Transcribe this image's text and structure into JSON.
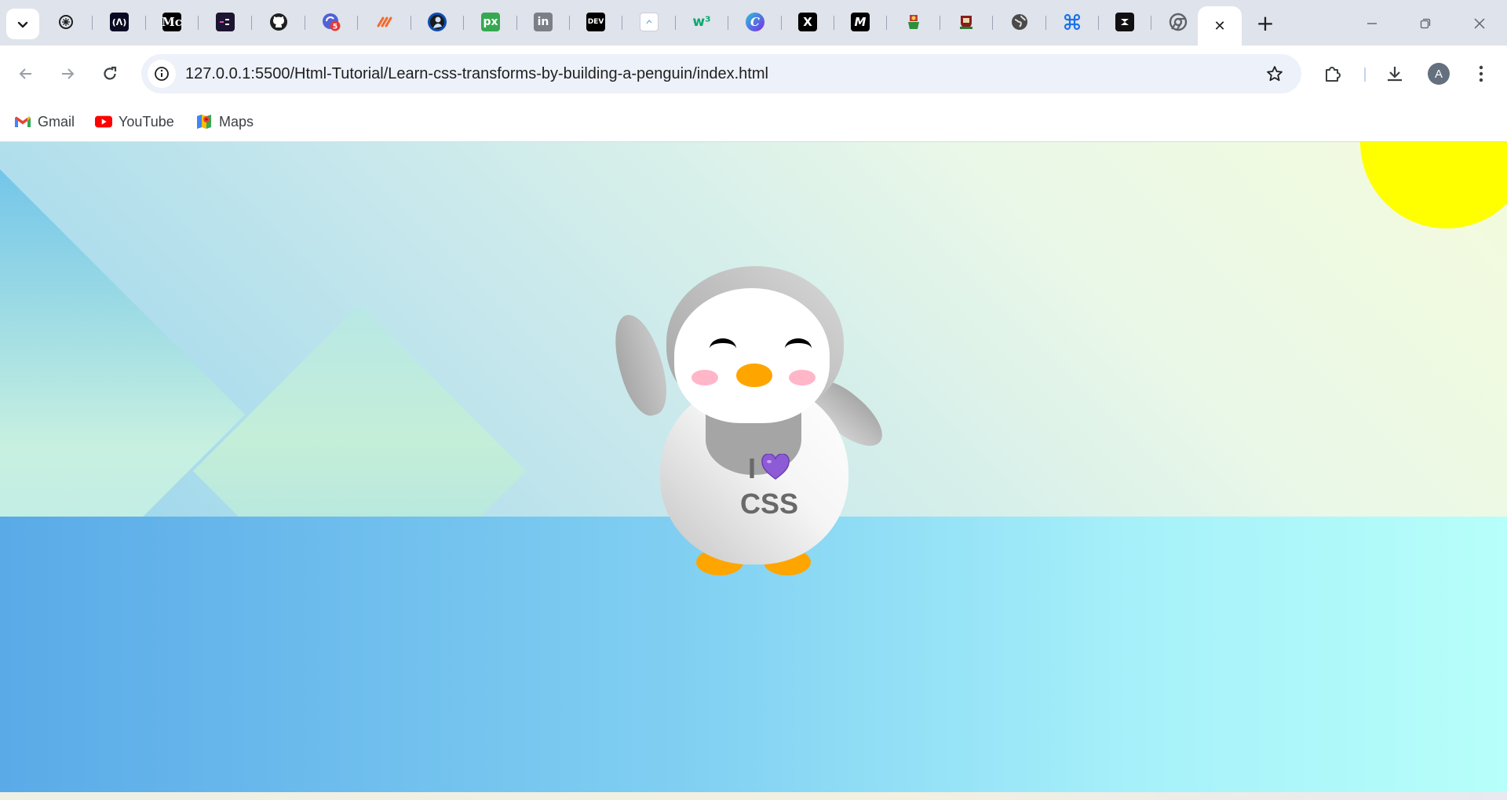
{
  "browser": {
    "pinned_tabs": [
      {
        "icon": "chatgpt-icon"
      },
      {
        "icon": "freecodecamp-icon"
      },
      {
        "icon": "medium-icon",
        "text": "M"
      },
      {
        "icon": "app-icon"
      },
      {
        "icon": "github-icon"
      },
      {
        "icon": "notification-app-icon",
        "badge": "5"
      },
      {
        "icon": "slash-icon"
      },
      {
        "icon": "avatar-icon"
      },
      {
        "icon": "pixel-icon",
        "text": "px"
      },
      {
        "icon": "linkedin-icon",
        "text": "in"
      },
      {
        "icon": "dev-icon",
        "text": "DEV"
      },
      {
        "icon": "page-icon"
      },
      {
        "icon": "w3schools-icon",
        "text": "w³"
      },
      {
        "icon": "canva-icon",
        "text": "C"
      },
      {
        "icon": "x-icon",
        "text": "X"
      },
      {
        "icon": "m-icon",
        "text": "M"
      },
      {
        "icon": "crest-icon"
      },
      {
        "icon": "crest-icon-2"
      },
      {
        "icon": "globe-icon"
      },
      {
        "icon": "command-icon"
      },
      {
        "icon": "dark-app-icon"
      },
      {
        "icon": "chrome-icon"
      }
    ],
    "active_tab_close": "✕",
    "new_tab": "+",
    "url": "127.0.0.1:5500/Html-Tutorial/Learn-css-transforms-by-building-a-penguin/index.html",
    "profile_initial": "A",
    "bookmarks": [
      {
        "label": "Gmail",
        "icon": "gmail-icon"
      },
      {
        "label": "YouTube",
        "icon": "youtube-icon"
      },
      {
        "label": "Maps",
        "icon": "maps-icon"
      }
    ]
  },
  "page": {
    "shirt_line1": "I",
    "shirt_line2": "CSS",
    "colors": {
      "sun": "#ffff00",
      "beak": "#ffa500",
      "cheek": "#ffb6c8",
      "heart": "#8e5bd6"
    }
  }
}
